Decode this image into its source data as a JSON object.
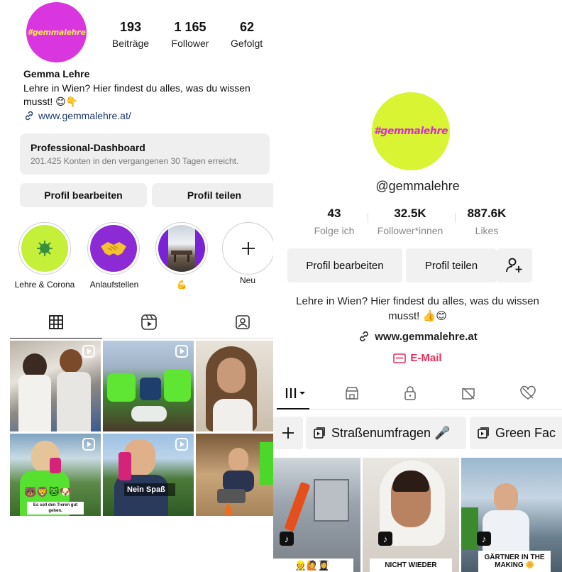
{
  "instagram": {
    "avatar_text": "#gemmalehre",
    "stats": [
      {
        "value": "193",
        "label": "Beiträge"
      },
      {
        "value": "1 165",
        "label": "Follower"
      },
      {
        "value": "62",
        "label": "Gefolgt"
      }
    ],
    "name": "Gemma Lehre",
    "bio": "Lehre in Wien? Hier findest du alles, was du wissen musst! 😊👇",
    "link": "www.gemmalehre.at/",
    "dashboard": {
      "title": "Professional-Dashboard",
      "subtitle": "201.425 Konten in den vergangenen 30 Tagen erreicht."
    },
    "buttons": {
      "edit": "Profil bearbeiten",
      "share": "Profil teilen"
    },
    "highlights": [
      {
        "label": "Lehre & Corona",
        "icon": "virus-icon"
      },
      {
        "label": "Anlaufstellen",
        "icon": "handshake-icon"
      },
      {
        "label": "💪",
        "icon": "office-photo"
      },
      {
        "label": "Neu",
        "icon": "plus-icon"
      }
    ],
    "tabs": [
      "grid-icon",
      "reels-icon",
      "tagged-icon"
    ],
    "tiles": [
      {
        "caption": ""
      },
      {
        "caption": ""
      },
      {
        "caption": ""
      },
      {
        "caption": "Es soll den Tieren gut gehen."
      },
      {
        "caption": "Nein Spaß"
      },
      {
        "caption": ""
      }
    ]
  },
  "tiktok": {
    "avatar_text": "#gemmalehre",
    "handle": "@gemmalehre",
    "stats": [
      {
        "value": "43",
        "label": "Folge ich"
      },
      {
        "value": "32.5K",
        "label": "Follower*innen"
      },
      {
        "value": "887.6K",
        "label": "Likes"
      }
    ],
    "buttons": {
      "edit": "Profil bearbeiten",
      "share": "Profil teilen"
    },
    "bio": "Lehre in Wien? Hier findest du alles, was du wissen musst! 👍😊",
    "link": "www.gemmalehre.at",
    "email": "E-Mail",
    "playlists": [
      "Straßenumfragen 🎤",
      "Green Fac"
    ],
    "videos": [
      {
        "caption": "👷🙋👩‍🎓"
      },
      {
        "caption": "NICHT WIEDER"
      },
      {
        "caption": "GÄRTNER IN THE MAKING 🌼"
      }
    ]
  },
  "colors": {
    "ig_avatar": "#d936e0",
    "tt_avatar": "#d8f432",
    "tt_email": "#e8305a"
  }
}
